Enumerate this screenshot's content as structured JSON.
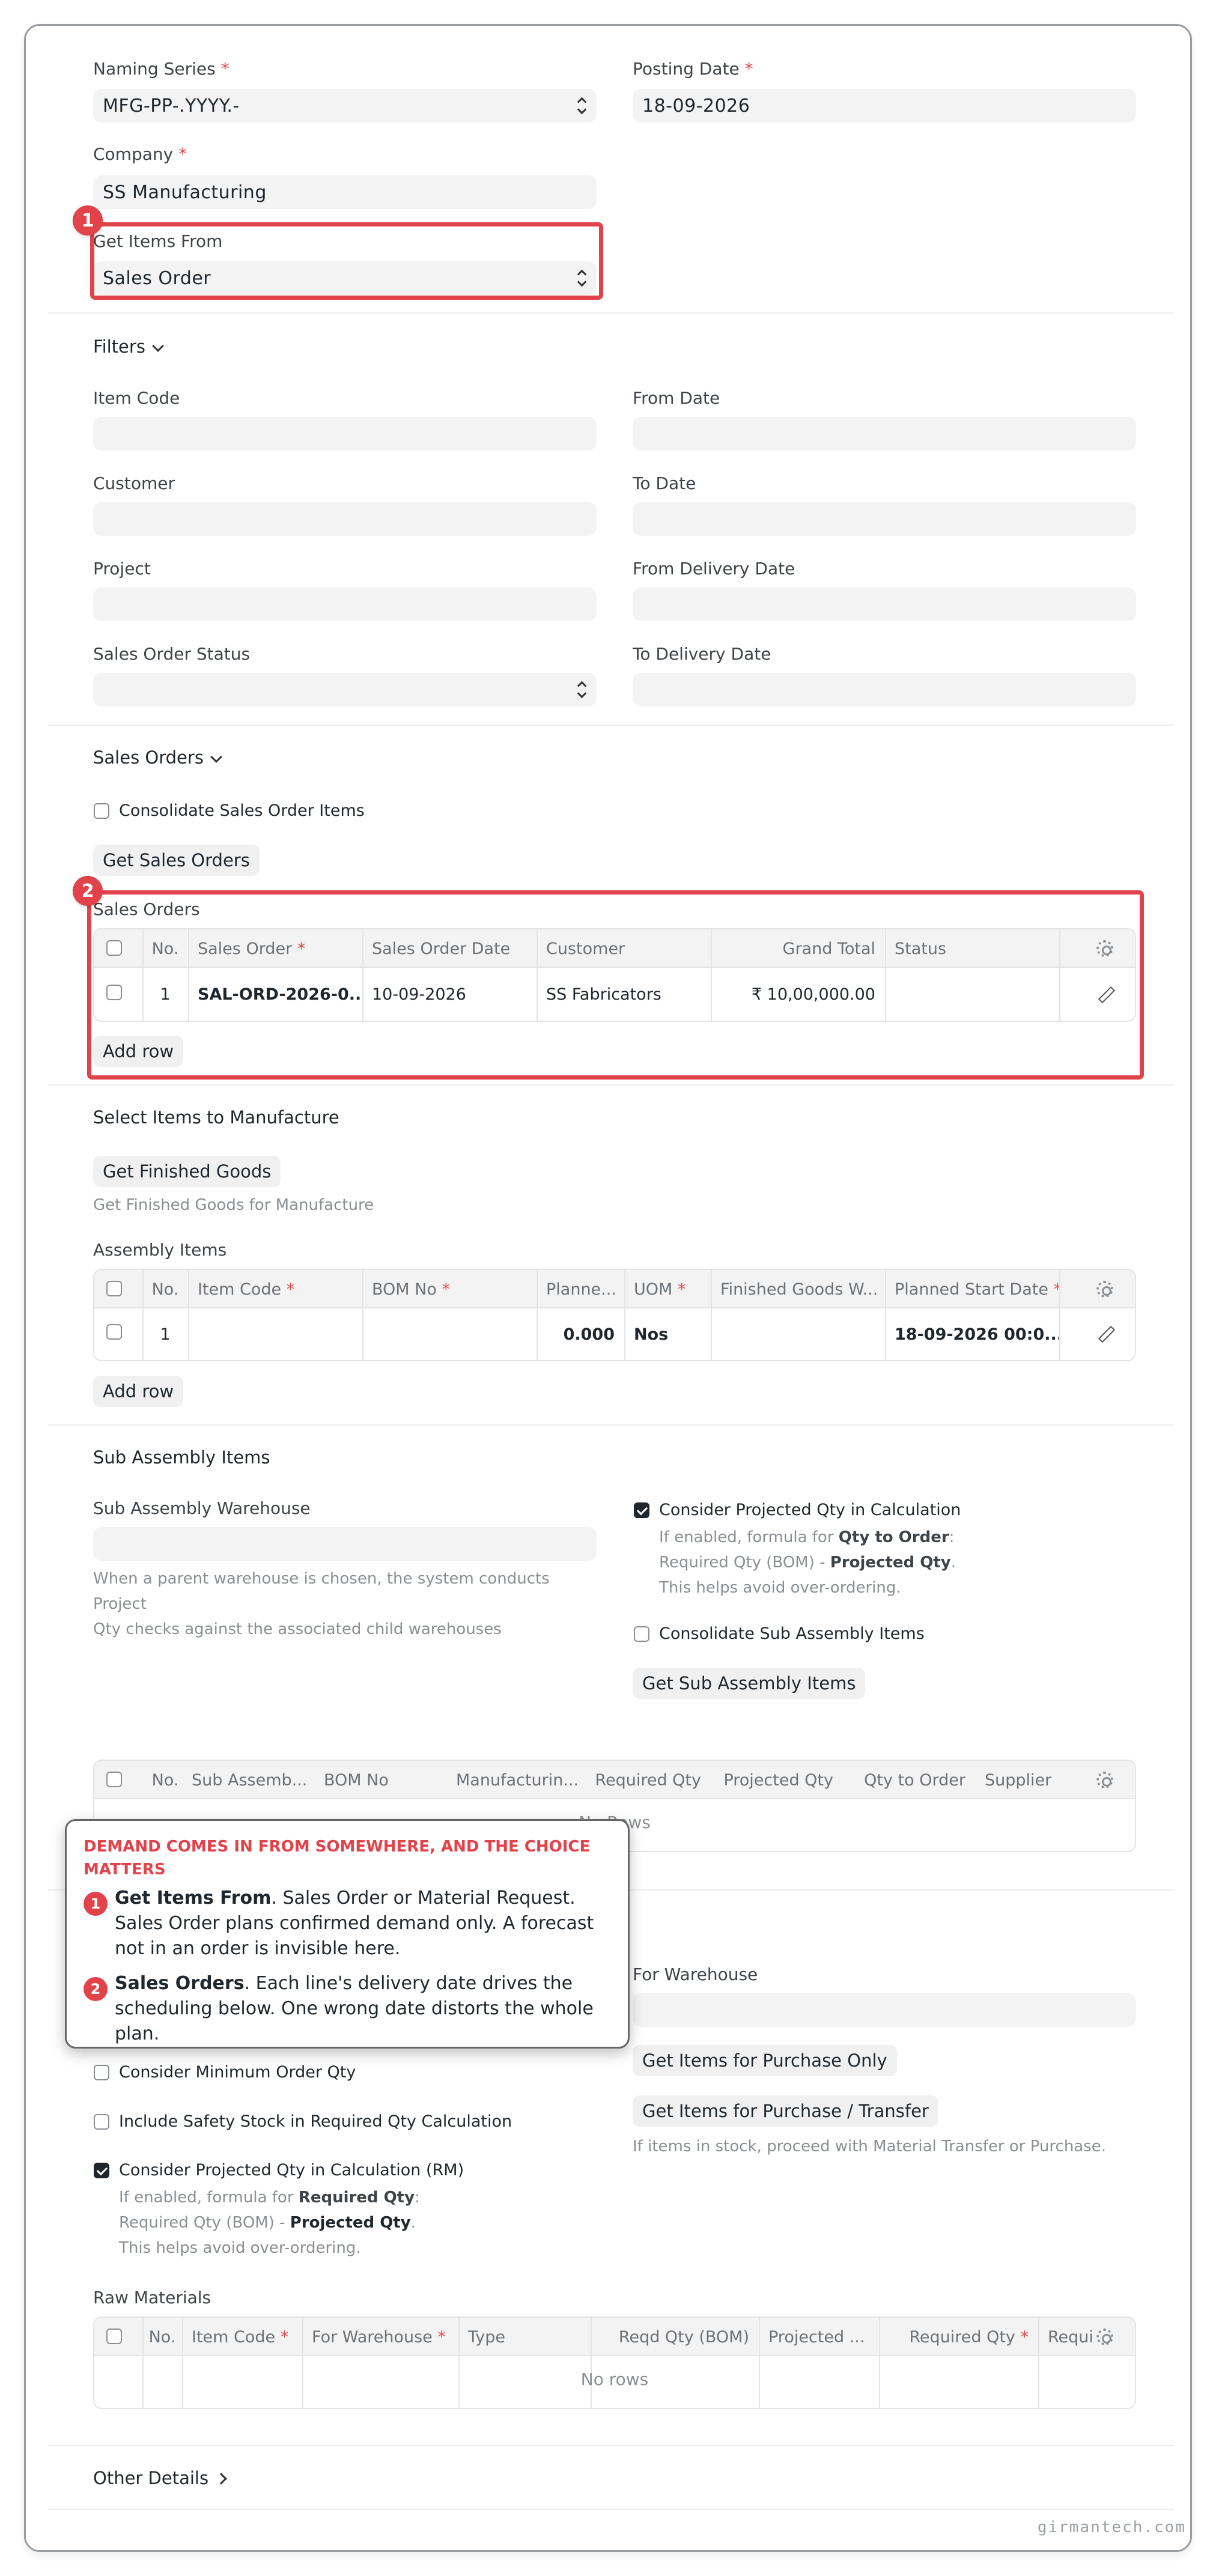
{
  "form": {
    "naming_series_label": "Naming Series",
    "naming_series_value": "MFG-PP-.YYYY.-",
    "posting_date_label": "Posting Date",
    "posting_date_value": "18-09-2026",
    "company_label": "Company",
    "company_value": "SS Manufacturing",
    "get_items_from_label": "Get Items From",
    "get_items_from_value": "Sales Order",
    "required_mark": "*"
  },
  "filters": {
    "title": "Filters",
    "item_code": "Item Code",
    "from_date": "From Date",
    "customer": "Customer",
    "to_date": "To Date",
    "project": "Project",
    "from_delivery_date": "From Delivery Date",
    "sales_order_status": "Sales Order Status",
    "to_delivery_date": "To Delivery Date"
  },
  "sales_orders_section": {
    "title": "Sales Orders",
    "consolidate_label": "Consolidate Sales Order Items",
    "get_button": "Get Sales Orders",
    "table_label": "Sales Orders",
    "headers": [
      "No.",
      "Sales Order",
      "Sales Order Date",
      "Customer",
      "Grand Total",
      "Status"
    ],
    "row": {
      "no": "1",
      "sales_order": "SAL-ORD-2026-0...",
      "date": "10-09-2026",
      "customer": "SS Fabricators",
      "grand_total": "₹ 10,00,000.00",
      "status": ""
    },
    "add_row": "Add row"
  },
  "manufacture": {
    "title": "Select Items to Manufacture",
    "get_button": "Get Finished Goods",
    "help": "Get Finished Goods for Manufacture",
    "table_label": "Assembly Items",
    "headers": [
      "No.",
      "Item Code",
      "BOM No",
      "Planne...",
      "UOM",
      "Finished Goods W...",
      "Planned Start Date"
    ],
    "row": {
      "no": "1",
      "item_code": "",
      "bom_no": "",
      "planned": "0.000",
      "uom": "Nos",
      "fg_warehouse": "",
      "start_date": "18-09-2026 00:0..."
    },
    "add_row": "Add row"
  },
  "sub_assembly": {
    "title": "Sub Assembly Items",
    "warehouse_label": "Sub Assembly Warehouse",
    "warehouse_help_1": "When a parent warehouse is chosen, the system conducts Project",
    "warehouse_help_2": "Qty checks against the associated child warehouses",
    "projected_label": "Consider Projected Qty in Calculation",
    "projected_help_1a": "If enabled, formula for ",
    "projected_help_1b": "Qty to Order",
    "projected_help_1c": ":",
    "projected_help_2a": "Required Qty (BOM) - ",
    "projected_help_2b": "Projected Qty",
    "projected_help_2c": ".",
    "projected_help_3": "This helps avoid over-ordering.",
    "consolidate_label": "Consolidate Sub Assembly Items",
    "get_button": "Get Sub Assembly Items",
    "headers": [
      "No.",
      "Sub Assemb...",
      "BOM No",
      "Manufacturin...",
      "Required Qty",
      "Projected Qty",
      "Qty to Order",
      "Supplier"
    ],
    "no_rows": "No Rows"
  },
  "material": {
    "for_warehouse_label": "For Warehouse",
    "min_order_label": "Consider Minimum Order Qty",
    "safety_stock_label": "Include Safety Stock in Required Qty Calculation",
    "projected_rm_label": "Consider Projected Qty in Calculation (RM)",
    "rm_help_1a": "If enabled, formula for ",
    "rm_help_1b": "Required Qty",
    "rm_help_1c": ":",
    "rm_help_2a": "Required Qty (BOM) - ",
    "rm_help_2b": "Projected Qty",
    "rm_help_2c": ".",
    "rm_help_3": "This helps avoid over-ordering.",
    "purchase_only_button": "Get Items for Purchase Only",
    "purchase_transfer_button": "Get Items for Purchase / Transfer",
    "transfer_help": "If items in stock, proceed with Material Transfer or Purchase.",
    "table_label": "Raw Materials",
    "headers": [
      "No.",
      "Item Code",
      "For Warehouse",
      "Type",
      "Reqd Qty (BOM)",
      "Projected ...",
      "Required Qty",
      "Requir"
    ],
    "no_rows": "No rows"
  },
  "other_details": "Other Details",
  "annotation": {
    "badge_1": "1",
    "badge_2": "2",
    "title": "DEMAND COMES IN FROM SOMEWHERE, AND THE CHOICE MATTERS",
    "p1_bold": "Get Items From",
    "p1_text": ". Sales Order or Material Request. Sales Order plans confirmed demand only. A forecast not in an order is invisible here.",
    "p2_bold": "Sales Orders",
    "p2_text": ". Each line's delivery date drives the scheduling below. One wrong date distorts the whole plan."
  },
  "watermark": "girmantech.com",
  "colors": {
    "highlight": "#e2424a",
    "required": "#e24c4c"
  }
}
